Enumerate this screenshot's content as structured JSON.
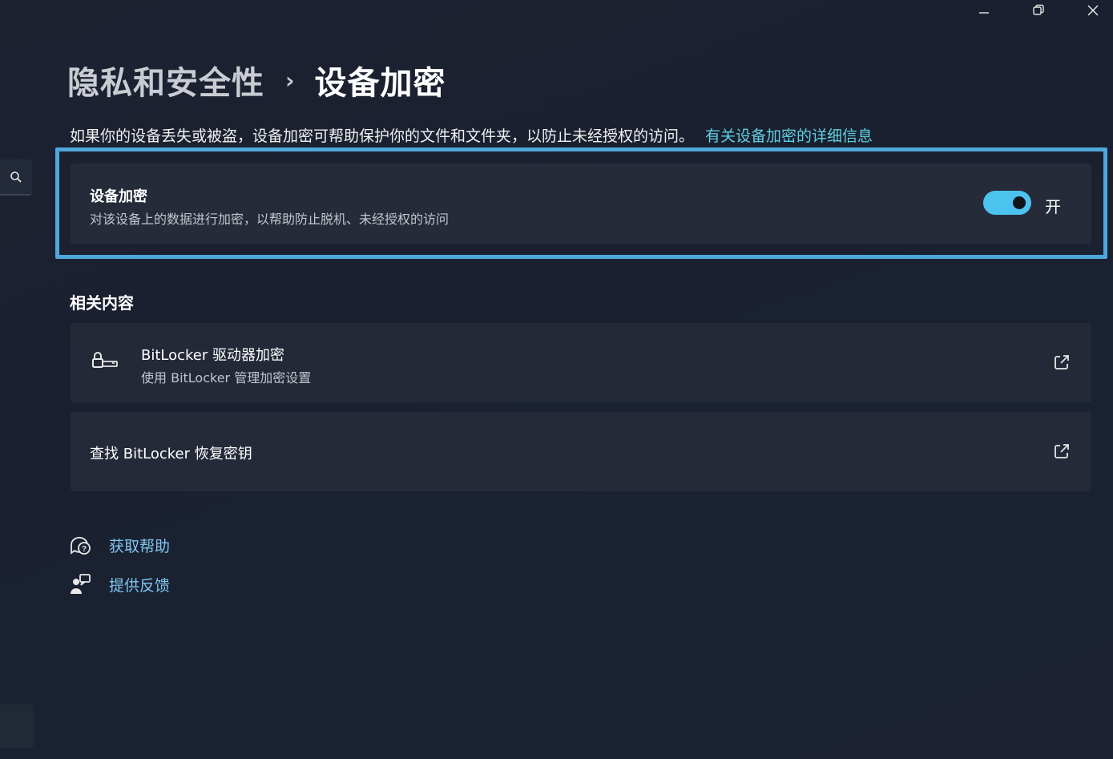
{
  "window": {
    "controls": [
      "minimize",
      "maximize",
      "close"
    ]
  },
  "breadcrumb": {
    "parent": "隐私和安全性",
    "separator": "›",
    "current": "设备加密"
  },
  "description": {
    "text": "如果你的设备丢失或被盗，设备加密可帮助保护你的文件和文件夹，以防止未经授权的访问。",
    "link": "有关设备加密的详细信息"
  },
  "device_encryption": {
    "title": "设备加密",
    "subtitle": "对该设备上的数据进行加密，以帮助防止脱机、未经授权的访问",
    "toggle_on": true,
    "toggle_label": "开",
    "accent": "#4cc2ee"
  },
  "related": {
    "title": "相关内容",
    "items": [
      {
        "title": "BitLocker 驱动器加密",
        "subtitle": "使用 BitLocker 管理加密设置",
        "icon": "bitlocker-key-icon"
      },
      {
        "title": "查找 BitLocker 恢复密钥",
        "icon": "external-link-icon"
      }
    ]
  },
  "footer": {
    "help": "获取帮助",
    "feedback": "提供反馈"
  }
}
